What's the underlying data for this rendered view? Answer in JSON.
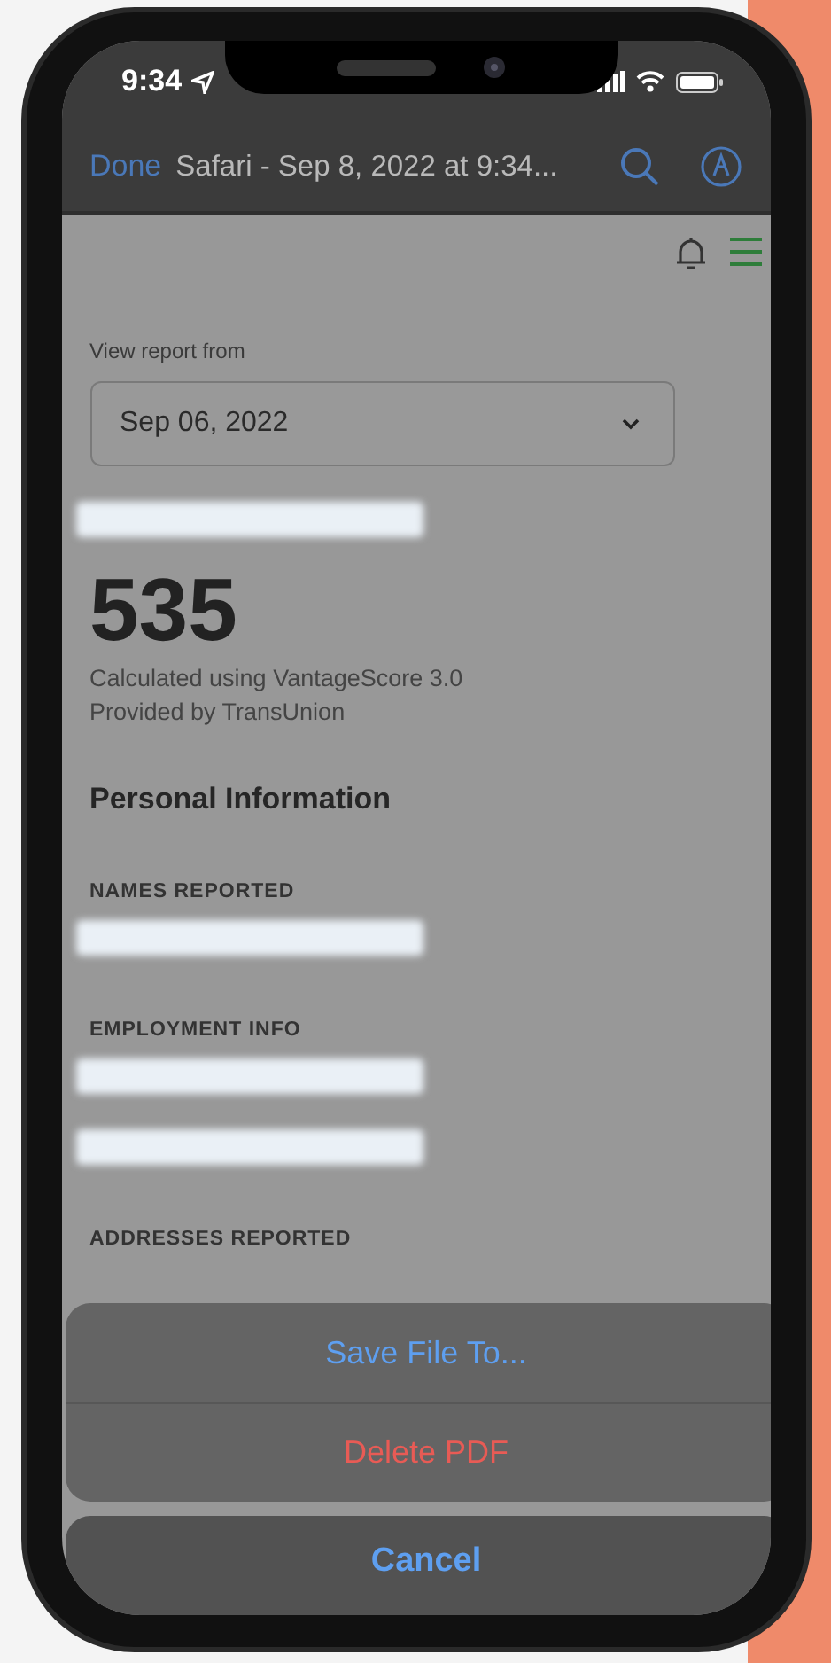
{
  "status_bar": {
    "time": "9:34"
  },
  "nav_bar": {
    "done": "Done",
    "title": "Safari - Sep 8, 2022 at 9:34..."
  },
  "report": {
    "view_label": "View report from",
    "date_select": {
      "value": "Sep 06, 2022"
    },
    "score": "535",
    "score_notes": [
      "Calculated using VantageScore 3.0",
      "Provided by TransUnion"
    ],
    "section_title": "Personal Information",
    "groups": [
      {
        "label": "NAMES REPORTED"
      },
      {
        "label": "EMPLOYMENT INFO"
      },
      {
        "label": "ADDRESSES REPORTED"
      }
    ]
  },
  "action_sheet": {
    "actions": [
      {
        "label": "Save File To...",
        "kind": "default"
      },
      {
        "label": "Delete PDF",
        "kind": "destructive"
      }
    ],
    "cancel": "Cancel"
  }
}
